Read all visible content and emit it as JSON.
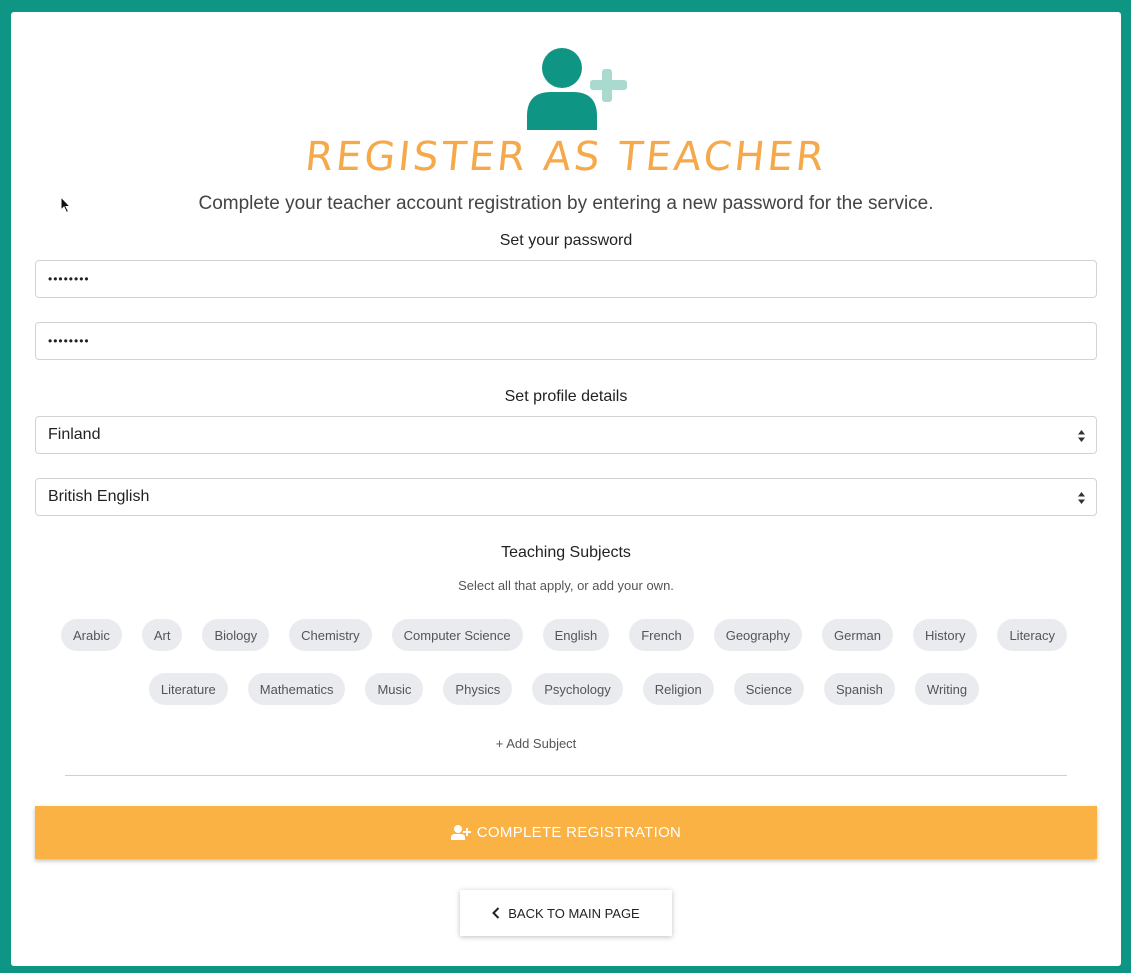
{
  "header": {
    "title": "REGISTER AS TEACHER",
    "subtitle": "Complete your teacher account registration by entering a new password for the service."
  },
  "password_section": {
    "label": "Set your password",
    "password_value": "••••••••",
    "confirm_value": "••••••••"
  },
  "profile_section": {
    "label": "Set profile details",
    "country_selected": "Finland",
    "language_selected": "British English"
  },
  "subjects_section": {
    "label": "Teaching Subjects",
    "hint": "Select all that apply, or add your own.",
    "row1": [
      "Arabic",
      "Art",
      "Biology",
      "Chemistry",
      "Computer Science",
      "English",
      "French",
      "Geography",
      "German",
      "History",
      "Literacy"
    ],
    "row2": [
      "Literature",
      "Mathematics",
      "Music",
      "Physics",
      "Psychology",
      "Religion",
      "Science",
      "Spanish",
      "Writing"
    ],
    "add_label": "+ Add Subject"
  },
  "actions": {
    "complete_label": "COMPLETE REGISTRATION",
    "back_label": "BACK TO MAIN PAGE"
  },
  "colors": {
    "background": "#0f9584",
    "accent_orange": "#f9b243",
    "title_orange": "#f5a94a",
    "icon_teal": "#0f9584",
    "icon_plus": "#a9d9cf"
  },
  "icons": {
    "logo": "user-plus-icon",
    "complete": "user-plus-icon",
    "back": "chevron-left-icon",
    "select_caret": "sort-caret-icon"
  }
}
